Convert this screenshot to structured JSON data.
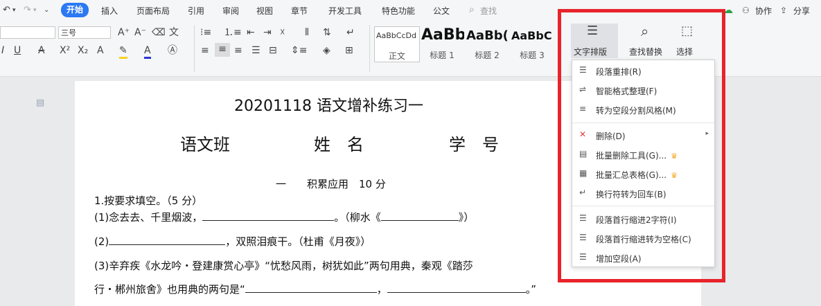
{
  "menu": {
    "tabs": [
      "开始",
      "插入",
      "页面布局",
      "引用",
      "审阅",
      "视图",
      "章节",
      "开发工具",
      "特色功能",
      "公文"
    ],
    "search_placeholder": "查找",
    "collab": "协作",
    "share": "分享"
  },
  "ribbon": {
    "font_name_value": "",
    "font_size_value": "三号",
    "styles": [
      {
        "sample": "AaBbCcDd",
        "name": "正文"
      },
      {
        "sample": "AaBb",
        "name": "标题 1"
      },
      {
        "sample": "AaBb(",
        "name": "标题 2"
      },
      {
        "sample": "AaBbC",
        "name": "标题 3"
      }
    ],
    "text_layout": "文字排版",
    "find_replace": "查找替换",
    "select": "选择"
  },
  "document": {
    "title": "20201118 语文增补练习一",
    "header_fields": [
      "语文班",
      "姓　名",
      "学　号"
    ],
    "section": "一　　积累应用　10 分",
    "q1": "1.按要求填空。（5 分）",
    "q1_1a": "(1)念去去、千里烟波，",
    "q1_1b": "。（柳水《",
    "q1_1c": "》）",
    "q1_2a": "(2)",
    "q1_2b": "，双照泪痕干。（杜甫《月夜》）",
    "q1_3": "(3)辛弃疾《水龙吟・登建康赏心亭》“忧愁风雨，树犹如此”两句用典，秦观《踏莎",
    "q1_3b": "行・郴州旅舍》也用典的两句是“",
    "q1_3c": "，",
    "q1_3d": "。”"
  },
  "dropdown": {
    "items": [
      {
        "label": "段落重排(R)",
        "icon": "paragraph-rearrange-icon",
        "glyph": "☰"
      },
      {
        "label": "智能格式整理(F)",
        "icon": "smart-format-icon",
        "glyph": "⇌"
      },
      {
        "label": "转为空段分割风格(M)",
        "icon": "empty-paragraph-icon",
        "glyph": "≡"
      },
      {
        "label": "删除(D)",
        "icon": "delete-icon",
        "glyph": "✕"
      },
      {
        "label": "批量删除工具(G)...",
        "icon": "batch-delete-icon",
        "glyph": "▤"
      },
      {
        "label": "批量汇总表格(G)...",
        "icon": "batch-table-icon",
        "glyph": "▦"
      },
      {
        "label": "换行符转为回车(B)",
        "icon": "line-break-icon",
        "glyph": "↵"
      },
      {
        "label": "段落首行缩进2字符(I)",
        "icon": "indent-icon",
        "glyph": "☰"
      },
      {
        "label": "段落首行缩进转为空格(C)",
        "icon": "indent-space-icon",
        "glyph": "☰"
      },
      {
        "label": "增加空段(A)",
        "icon": "add-paragraph-icon",
        "glyph": "☰"
      }
    ]
  },
  "colors": {
    "accent": "#2b79f3",
    "highlight_border": "#e8232b",
    "crown": "#f5a623"
  }
}
